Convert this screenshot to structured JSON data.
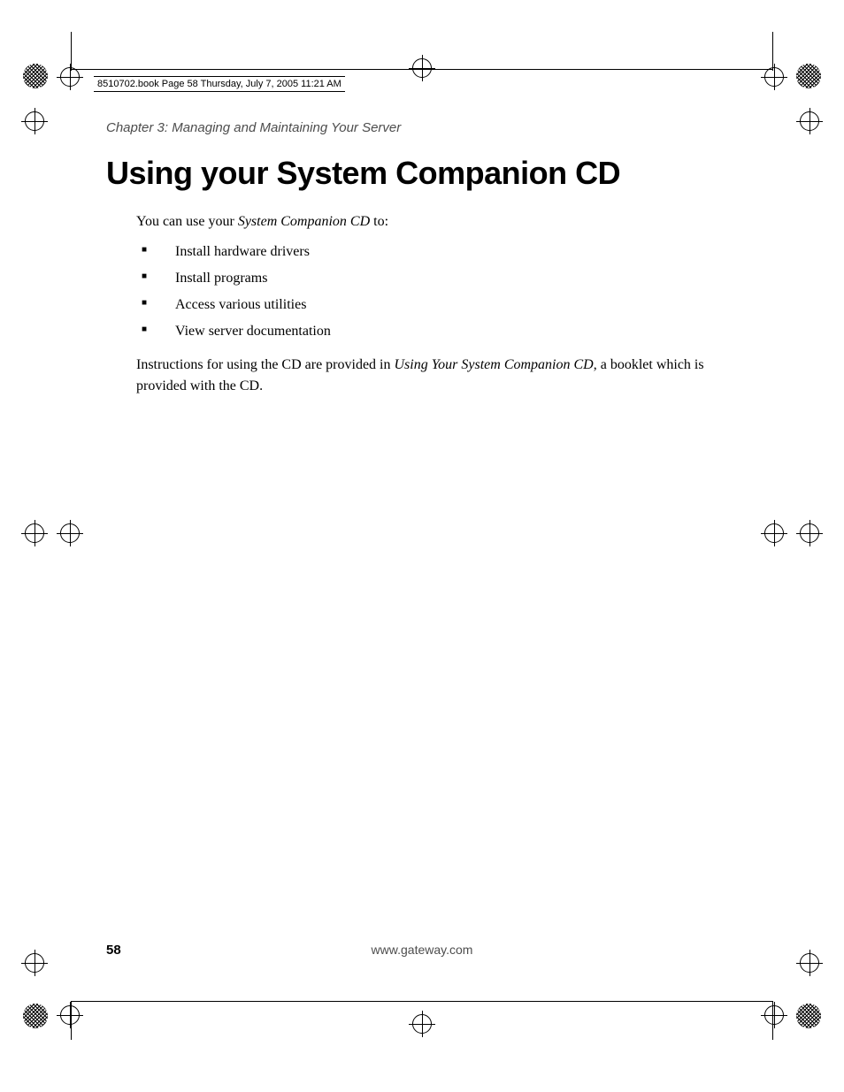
{
  "meta_line": "8510702.book  Page 58  Thursday, July 7, 2005  11:21 AM",
  "chapter_label": "Chapter 3: Managing and Maintaining Your Server",
  "title": "Using your System Companion CD",
  "intro_prefix": "You can use your ",
  "intro_italic": "System Companion CD",
  "intro_suffix": " to:",
  "bullets": [
    "Install hardware drivers",
    "Install programs",
    "Access various utilities",
    "View server documentation"
  ],
  "para2_prefix": "Instructions for using the CD are provided in ",
  "para2_italic": "Using Your System Companion CD",
  "para2_suffix": ", a booklet which is provided with the CD.",
  "page_number": "58",
  "footer_url": "www.gateway.com"
}
